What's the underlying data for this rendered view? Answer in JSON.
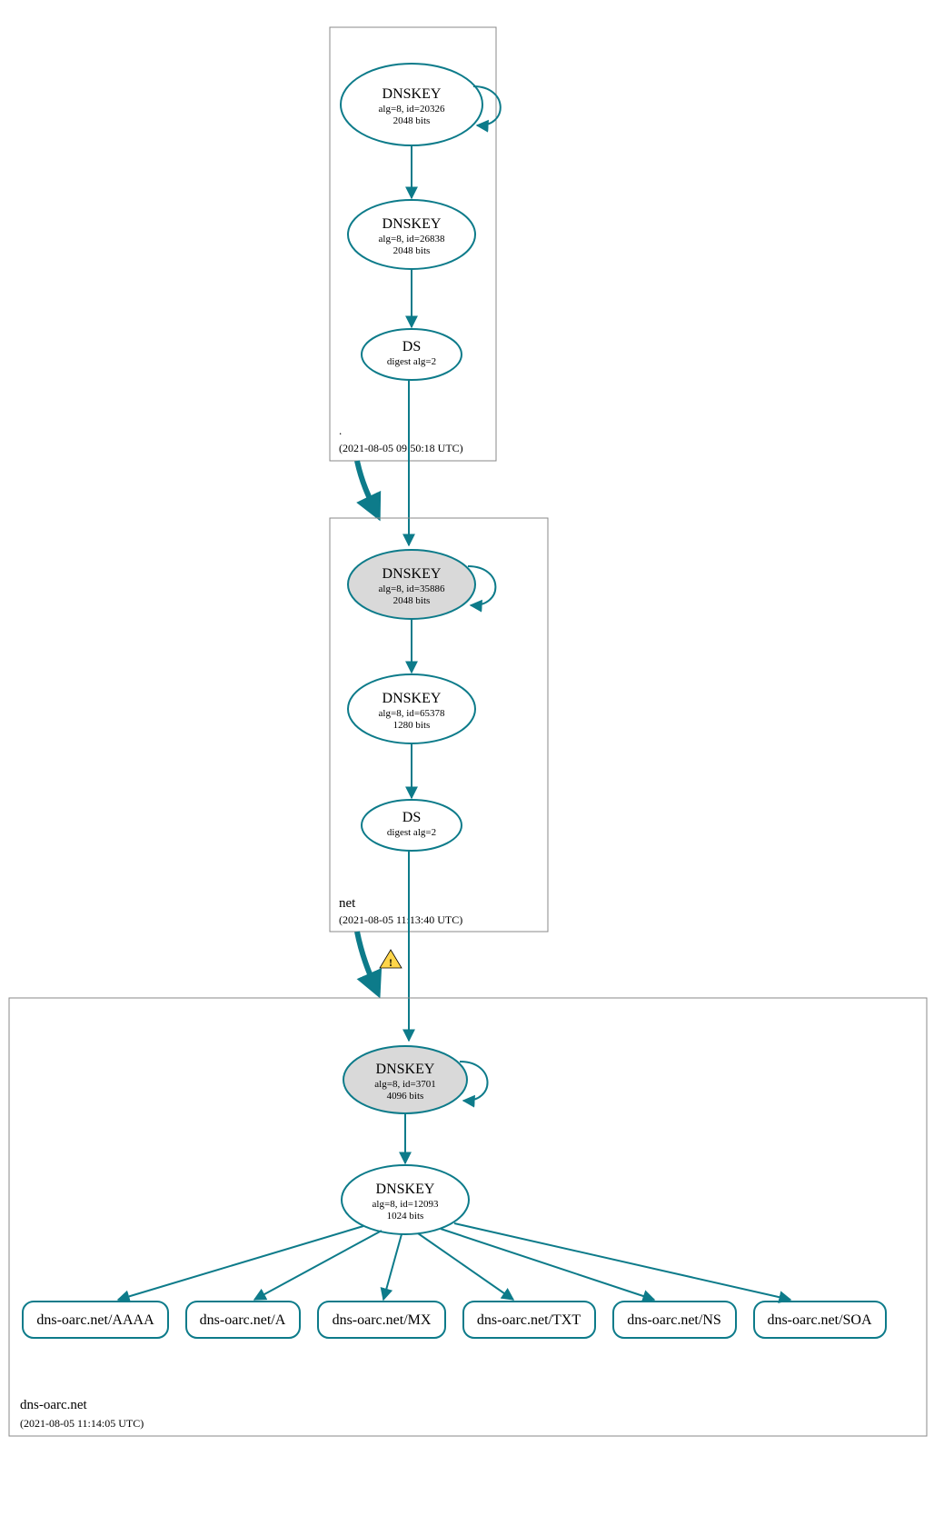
{
  "zones": {
    "root": {
      "name": ".",
      "timestamp": "(2021-08-05 09:50:18 UTC)",
      "ksk": {
        "title": "DNSKEY",
        "line1": "alg=8, id=20326",
        "line2": "2048 bits"
      },
      "zsk": {
        "title": "DNSKEY",
        "line1": "alg=8, id=26838",
        "line2": "2048 bits"
      },
      "ds": {
        "title": "DS",
        "line1": "digest alg=2"
      }
    },
    "net": {
      "name": "net",
      "timestamp": "(2021-08-05 11:13:40 UTC)",
      "ksk": {
        "title": "DNSKEY",
        "line1": "alg=8, id=35886",
        "line2": "2048 bits"
      },
      "zsk": {
        "title": "DNSKEY",
        "line1": "alg=8, id=65378",
        "line2": "1280 bits"
      },
      "ds": {
        "title": "DS",
        "line1": "digest alg=2"
      }
    },
    "domain": {
      "name": "dns-oarc.net",
      "timestamp": "(2021-08-05 11:14:05 UTC)",
      "ksk": {
        "title": "DNSKEY",
        "line1": "alg=8, id=3701",
        "line2": "4096 bits"
      },
      "zsk": {
        "title": "DNSKEY",
        "line1": "alg=8, id=12093",
        "line2": "1024 bits"
      },
      "records": {
        "aaaa": "dns-oarc.net/AAAA",
        "a": "dns-oarc.net/A",
        "mx": "dns-oarc.net/MX",
        "txt": "dns-oarc.net/TXT",
        "ns": "dns-oarc.net/NS",
        "soa": "dns-oarc.net/SOA"
      }
    }
  },
  "warning_icon": "!"
}
